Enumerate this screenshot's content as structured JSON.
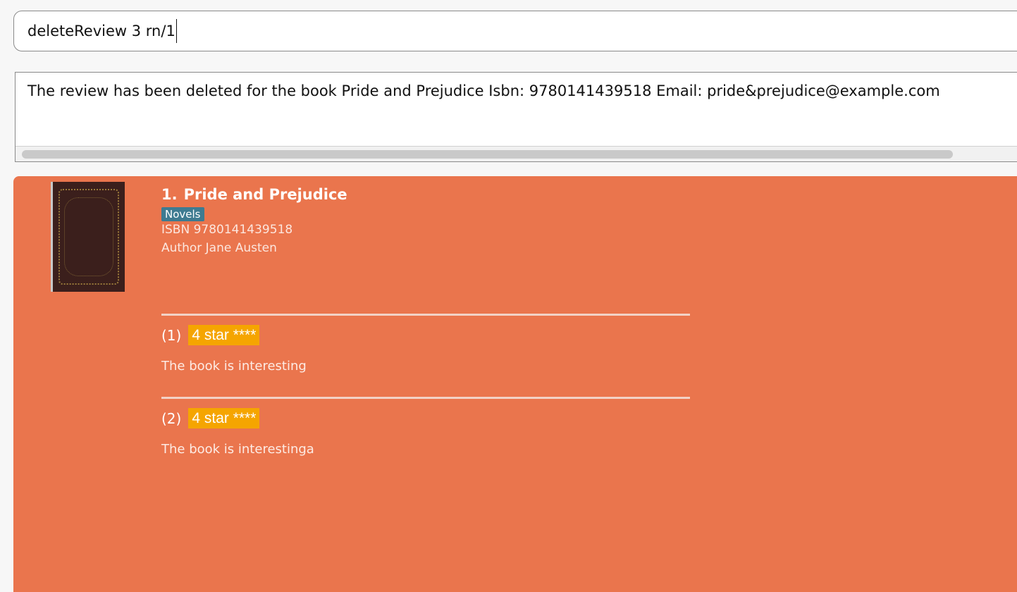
{
  "command_box": {
    "value": "deleteReview 3 rn/1"
  },
  "result_display": {
    "message": "The review has been deleted for the book Pride and Prejudice Isbn: 9780141439518 Email: pride&prejudice@example.com"
  },
  "book": {
    "index": "1.",
    "title": "Pride and Prejudice",
    "tag": "Novels",
    "isbn": "ISBN 9780141439518",
    "author": "Author Jane Austen",
    "cover_icon": "book-cover-image",
    "reviews": [
      {
        "number": "(1)",
        "rating": "4 star ****",
        "text": "The book is interesting"
      },
      {
        "number": "(2)",
        "rating": "4 star ****",
        "text": "The book is interestinga"
      }
    ]
  },
  "colors": {
    "card_background": "#ea754d",
    "tag_background": "#3e7b91",
    "rating_background": "#f5a500"
  }
}
